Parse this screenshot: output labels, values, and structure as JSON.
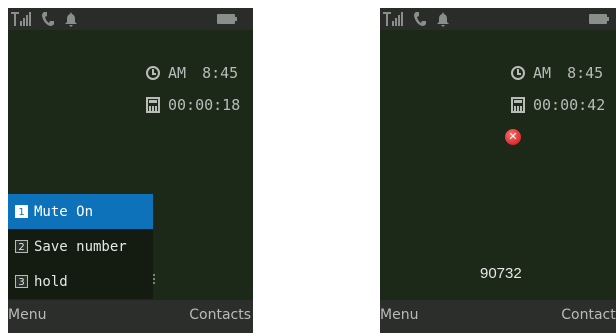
{
  "screen_left": {
    "clock": {
      "icon": "clock-icon",
      "ampm": "AM",
      "time": "8:45"
    },
    "timer": {
      "icon": "call-counter-icon",
      "value": "00:00:18"
    },
    "menu": [
      {
        "number": "1",
        "label": "Mute On",
        "selected": true
      },
      {
        "number": "2",
        "label": "Save number",
        "selected": false
      },
      {
        "number": "3",
        "label": "hold",
        "selected": false
      }
    ],
    "softkeys": {
      "left": "Menu",
      "right": "Contacts"
    }
  },
  "screen_right": {
    "clock": {
      "icon": "clock-icon",
      "ampm": "AM",
      "time": "8:45"
    },
    "timer": {
      "icon": "call-counter-icon",
      "value": "00:00:42"
    },
    "status_icon": "close-icon",
    "dialed_number": "90732",
    "softkeys": {
      "left": "Menu",
      "right": "Contacts"
    }
  },
  "status_bar": {
    "icons": [
      "signal-icon",
      "call-icon",
      "bell-icon",
      "battery-icon"
    ]
  },
  "colors": {
    "screen_bg": "#1c2818",
    "selection": "#0d72b9",
    "softkey_bg": "#2b2e2b",
    "close_icon": "#c81414"
  }
}
